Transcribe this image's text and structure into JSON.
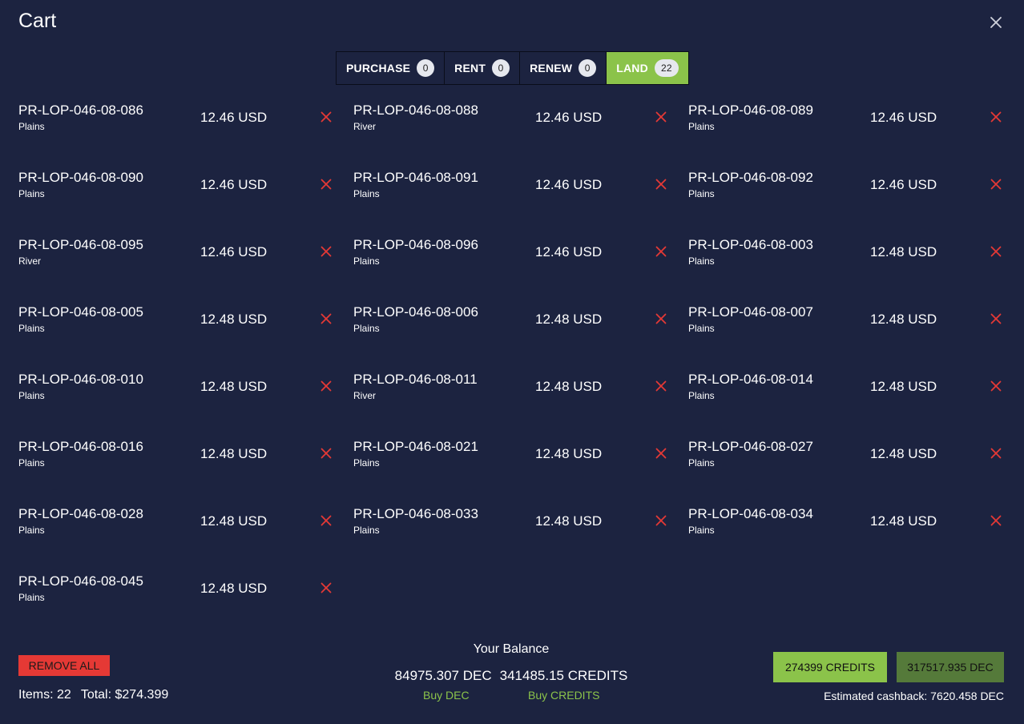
{
  "header": {
    "title": "Cart"
  },
  "tabs": [
    {
      "label": "PURCHASE",
      "count": "0",
      "active": false
    },
    {
      "label": "RENT",
      "count": "0",
      "active": false
    },
    {
      "label": "RENEW",
      "count": "0",
      "active": false
    },
    {
      "label": "LAND",
      "count": "22",
      "active": true
    }
  ],
  "items": [
    {
      "code": "PR-LOP-046-08-086",
      "terrain": "Plains",
      "price": "12.46 USD"
    },
    {
      "code": "PR-LOP-046-08-088",
      "terrain": "River",
      "price": "12.46 USD"
    },
    {
      "code": "PR-LOP-046-08-089",
      "terrain": "Plains",
      "price": "12.46 USD"
    },
    {
      "code": "PR-LOP-046-08-090",
      "terrain": "Plains",
      "price": "12.46 USD"
    },
    {
      "code": "PR-LOP-046-08-091",
      "terrain": "Plains",
      "price": "12.46 USD"
    },
    {
      "code": "PR-LOP-046-08-092",
      "terrain": "Plains",
      "price": "12.46 USD"
    },
    {
      "code": "PR-LOP-046-08-095",
      "terrain": "River",
      "price": "12.46 USD"
    },
    {
      "code": "PR-LOP-046-08-096",
      "terrain": "Plains",
      "price": "12.46 USD"
    },
    {
      "code": "PR-LOP-046-08-003",
      "terrain": "Plains",
      "price": "12.48 USD"
    },
    {
      "code": "PR-LOP-046-08-005",
      "terrain": "Plains",
      "price": "12.48 USD"
    },
    {
      "code": "PR-LOP-046-08-006",
      "terrain": "Plains",
      "price": "12.48 USD"
    },
    {
      "code": "PR-LOP-046-08-007",
      "terrain": "Plains",
      "price": "12.48 USD"
    },
    {
      "code": "PR-LOP-046-08-010",
      "terrain": "Plains",
      "price": "12.48 USD"
    },
    {
      "code": "PR-LOP-046-08-011",
      "terrain": "River",
      "price": "12.48 USD"
    },
    {
      "code": "PR-LOP-046-08-014",
      "terrain": "Plains",
      "price": "12.48 USD"
    },
    {
      "code": "PR-LOP-046-08-016",
      "terrain": "Plains",
      "price": "12.48 USD"
    },
    {
      "code": "PR-LOP-046-08-021",
      "terrain": "Plains",
      "price": "12.48 USD"
    },
    {
      "code": "PR-LOP-046-08-027",
      "terrain": "Plains",
      "price": "12.48 USD"
    },
    {
      "code": "PR-LOP-046-08-028",
      "terrain": "Plains",
      "price": "12.48 USD"
    },
    {
      "code": "PR-LOP-046-08-033",
      "terrain": "Plains",
      "price": "12.48 USD"
    },
    {
      "code": "PR-LOP-046-08-034",
      "terrain": "Plains",
      "price": "12.48 USD"
    },
    {
      "code": "PR-LOP-046-08-045",
      "terrain": "Plains",
      "price": "12.48 USD"
    }
  ],
  "footer": {
    "remove_all_label": "REMOVE ALL",
    "items_text": "Items: 22",
    "total_text": "Total: $274.399",
    "balance": {
      "title": "Your Balance",
      "dec": "84975.307 DEC",
      "credits": "341485.15 CREDITS",
      "buy_dec_label": "Buy DEC",
      "buy_credits_label": "Buy CREDITS"
    },
    "pay_credits_label": "274399 CREDITS",
    "pay_dec_label": "317517.935 DEC",
    "cashback_text": "Estimated cashback: 7620.458 DEC"
  },
  "colors": {
    "background": "#1c2340",
    "accent_green": "#8bc34a",
    "dark_green": "#557a3a",
    "remove_red": "#e53935"
  },
  "icons": {
    "close": "close-icon",
    "remove": "remove-x-icon"
  }
}
